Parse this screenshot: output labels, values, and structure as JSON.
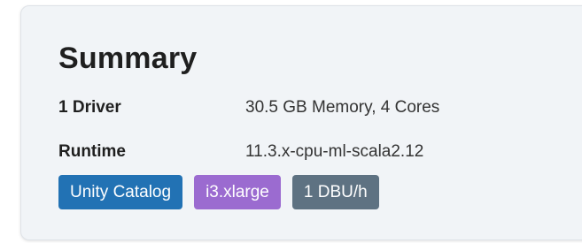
{
  "summary": {
    "title": "Summary",
    "rows": [
      {
        "label": "1 Driver",
        "value": "30.5 GB Memory, 4 Cores"
      },
      {
        "label": "Runtime",
        "value": "11.3.x-cpu-ml-scala2.12"
      }
    ],
    "tags": [
      {
        "label": "Unity Catalog",
        "color": "#2272b4"
      },
      {
        "label": "i3.xlarge",
        "color": "#9b6bd0"
      },
      {
        "label": "1 DBU/h",
        "color": "#5e7282"
      }
    ]
  }
}
